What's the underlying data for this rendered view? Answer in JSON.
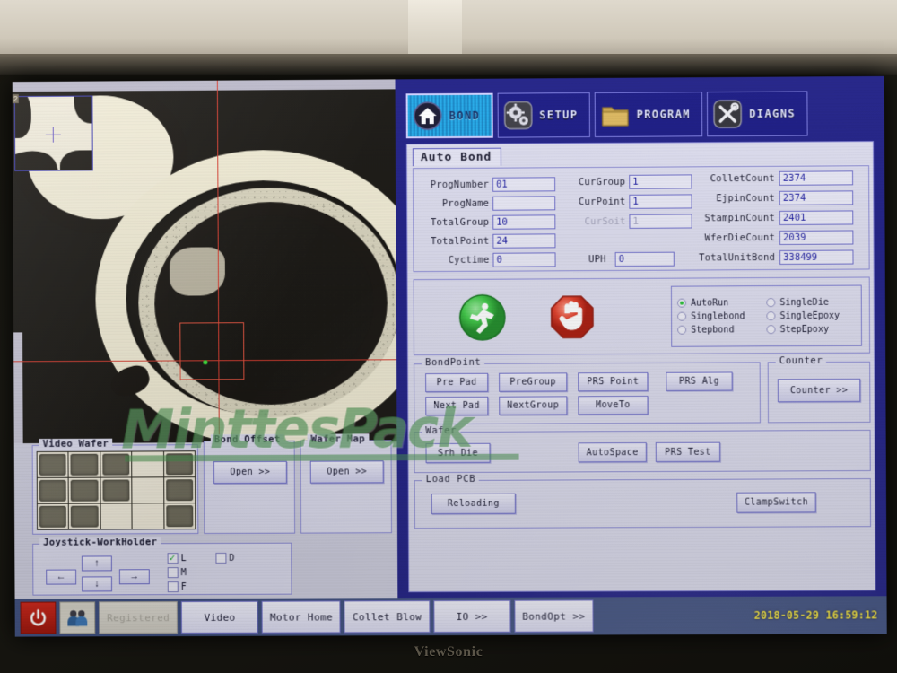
{
  "monitor": {
    "brand": "ViewSonic"
  },
  "nav_tabs": [
    {
      "label": "BOND",
      "icon": "home-icon",
      "active": true
    },
    {
      "label": "SETUP",
      "icon": "gears-icon",
      "active": false
    },
    {
      "label": "PROGRAM",
      "icon": "folder-icon",
      "active": false
    },
    {
      "label": "DIAGNS",
      "icon": "tools-icon",
      "active": false
    }
  ],
  "content": {
    "tab_title": "Auto Bond",
    "fields_left": [
      {
        "label": "ProgNumber",
        "value": "01",
        "dim": false
      },
      {
        "label": "ProgName",
        "value": "",
        "dim": false
      },
      {
        "label": "TotalGroup",
        "value": "10",
        "dim": false
      },
      {
        "label": "TotalPoint",
        "value": "24",
        "dim": false
      },
      {
        "label": "Cyctime",
        "value": "0",
        "dim": false
      }
    ],
    "fields_mid": [
      {
        "label": "CurGroup",
        "value": "1",
        "dim": false
      },
      {
        "label": "CurPoint",
        "value": "1",
        "dim": false
      },
      {
        "label": "CurSoit",
        "value": "1",
        "dim": true
      },
      {
        "label": "UPH",
        "value": "0",
        "dim": false
      }
    ],
    "fields_right": [
      {
        "label": "ColletCount",
        "value": "2374",
        "dim": false
      },
      {
        "label": "EjpinCount",
        "value": "2374",
        "dim": false
      },
      {
        "label": "StampinCount",
        "value": "2401",
        "dim": false
      },
      {
        "label": "WferDieCount",
        "value": "2039",
        "dim": false
      },
      {
        "label": "TotalUnitBond",
        "value": "338499",
        "dim": false
      }
    ],
    "run": {
      "start_icon": "run-start-icon",
      "stop_icon": "stop-hand-icon",
      "modes": [
        {
          "label": "AutoRun",
          "checked": true
        },
        {
          "label": "SingleDie",
          "checked": false
        },
        {
          "label": "Singlebond",
          "checked": false
        },
        {
          "label": "SingleEpoxy",
          "checked": false
        },
        {
          "label": "Stepbond",
          "checked": false
        },
        {
          "label": "StepEpoxy",
          "checked": false
        }
      ]
    },
    "bondpoint": {
      "legend": "BondPoint",
      "buttons": [
        "Pre Pad",
        "PreGroup",
        "PRS Point",
        "PRS Alg",
        "Next Pad",
        "NextGroup",
        "MoveTo"
      ]
    },
    "counter": {
      "legend": "Counter",
      "button": "Counter  >>"
    },
    "wafer": {
      "legend": "Wafer",
      "buttons": [
        "Srh Die",
        "AutoSpace",
        "PRS Test"
      ]
    },
    "loadpcb": {
      "legend": "Load PCB",
      "buttons": [
        "Reloading",
        "ClampSwitch"
      ]
    }
  },
  "lower_left": {
    "video_wafer": {
      "legend": "Video Wafer"
    },
    "bond_offset": {
      "legend": "Bond Offset",
      "button": "Open  >>"
    },
    "wafer_map": {
      "legend": "Wafer Map",
      "button": "Open  >>"
    },
    "joystick": {
      "legend": "Joystick-WorkHolder",
      "arrows": [
        "←",
        "↑",
        "↓",
        "→"
      ],
      "checkboxes": [
        {
          "label": "L",
          "checked": true
        },
        {
          "label": "D",
          "checked": false
        },
        {
          "label": "M",
          "checked": false
        },
        {
          "label": "F",
          "checked": false
        }
      ]
    }
  },
  "camera": {
    "inset_label": "2",
    "watermark": "MinttesPack"
  },
  "status_bar": {
    "power_icon": "power-icon",
    "user_icon": "users-icon",
    "buttons": [
      {
        "label": "Registered",
        "disabled": true
      },
      {
        "label": "Video",
        "disabled": false
      },
      {
        "label": "Motor Home",
        "disabled": false
      },
      {
        "label": "Collet Blow",
        "disabled": false
      },
      {
        "label": "IO  >>",
        "disabled": false
      },
      {
        "label": "BondOpt  >>",
        "disabled": false
      }
    ],
    "datetime": "2018-05-29 16:59:12"
  },
  "colors": {
    "nav_bg": "#1d1d85",
    "active_tab": "#1fa8e8",
    "panel_bg": "#dcdcee",
    "border": "#6f6fca",
    "status_bar": "#3e4f80",
    "datetime": "#f2e23a",
    "start_green": "#2fbf38",
    "stop_red": "#dd3322",
    "watermark_green": "#428e48"
  }
}
